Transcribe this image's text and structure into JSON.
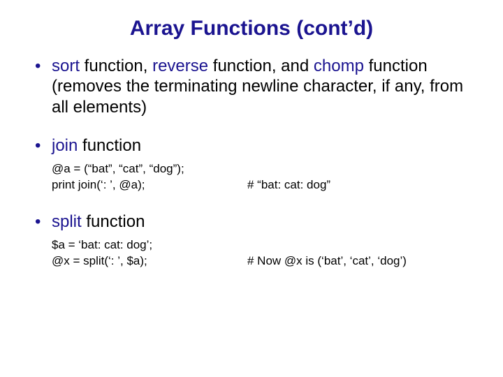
{
  "title": "Array Functions (cont’d)",
  "bullets": {
    "b1": {
      "sort": "sort",
      "t1": " function, ",
      "reverse": "reverse",
      "t2": " function, and ",
      "chomp": "chomp",
      "t3": " function (removes the terminating newline character, if any, from all elements)"
    },
    "b2": {
      "join": "join",
      "t1": " function",
      "code1": "@a = (“bat”, “cat”, “dog”);",
      "code2": "print  join(‘: ’, @a);",
      "comment": "# “bat: cat: dog”"
    },
    "b3": {
      "split": "split",
      "t1": " function",
      "code1": "$a = ‘bat: cat: dog’;",
      "code2": "@x = split(‘: ’, $a);",
      "comment": "# Now @x is (‘bat’, ‘cat’, ‘dog’)"
    }
  }
}
